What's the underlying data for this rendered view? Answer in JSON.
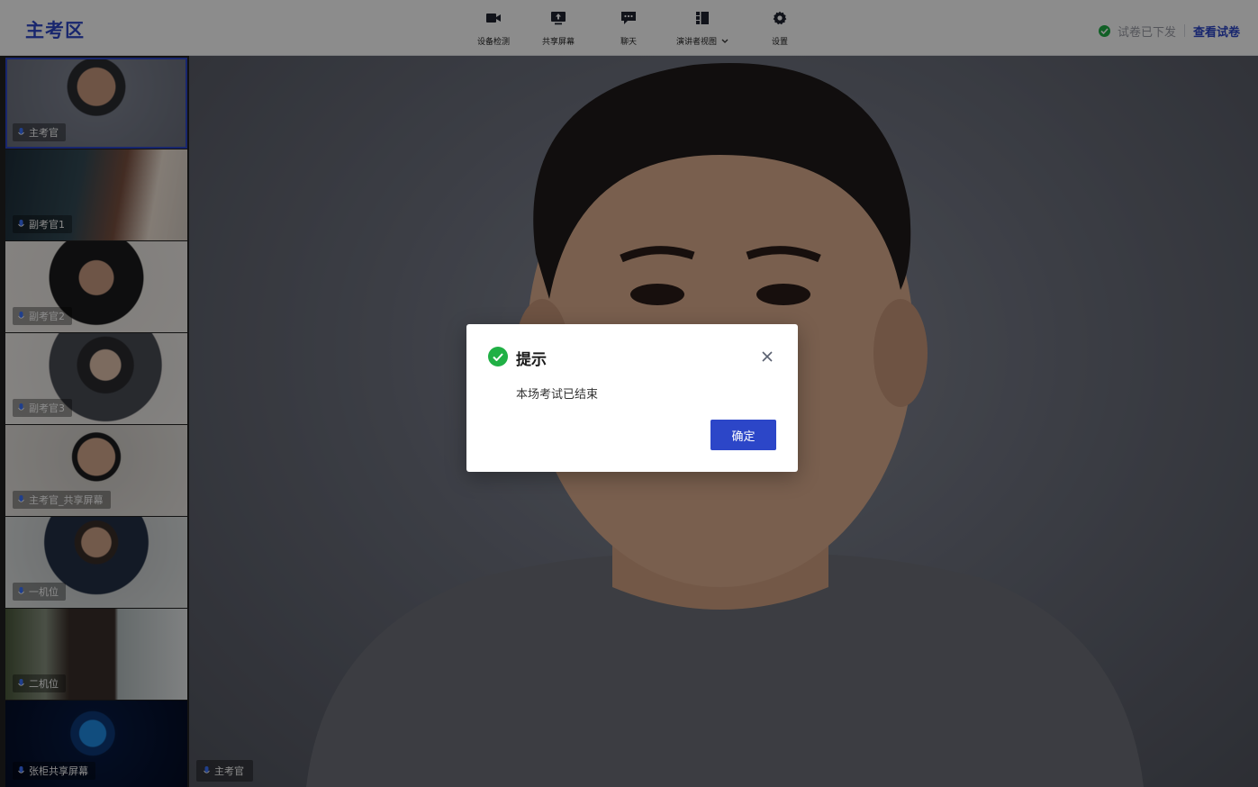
{
  "app": {
    "title": "主考区"
  },
  "toolbar": {
    "items": [
      {
        "label": "设备检测",
        "icon": "camera-icon"
      },
      {
        "label": "共享屏幕",
        "icon": "share-screen-icon"
      },
      {
        "label": "聊天",
        "icon": "chat-icon"
      },
      {
        "label": "演讲者视图",
        "icon": "speaker-view-icon",
        "has_dropdown": true
      },
      {
        "label": "设置",
        "icon": "gear-icon"
      }
    ]
  },
  "header_right": {
    "status_text": "试卷已下发",
    "status_icon": "check-circle-icon",
    "view_paper_label": "查看试卷"
  },
  "sidebar": {
    "participants": [
      {
        "name": "主考官",
        "active": true
      },
      {
        "name": "副考官1"
      },
      {
        "name": "副考官2"
      },
      {
        "name": "副考官3"
      },
      {
        "name": "主考官_共享屏幕"
      },
      {
        "name": "一机位"
      },
      {
        "name": "二机位"
      },
      {
        "name": "张柜共享屏幕"
      }
    ]
  },
  "stage": {
    "speaker_name": "主考官"
  },
  "dialog": {
    "title": "提示",
    "message": "本场考试已结束",
    "confirm_label": "确定"
  },
  "colors": {
    "accent": "#2c46c8",
    "success": "#20b045",
    "muted_text": "#9b9da6"
  }
}
